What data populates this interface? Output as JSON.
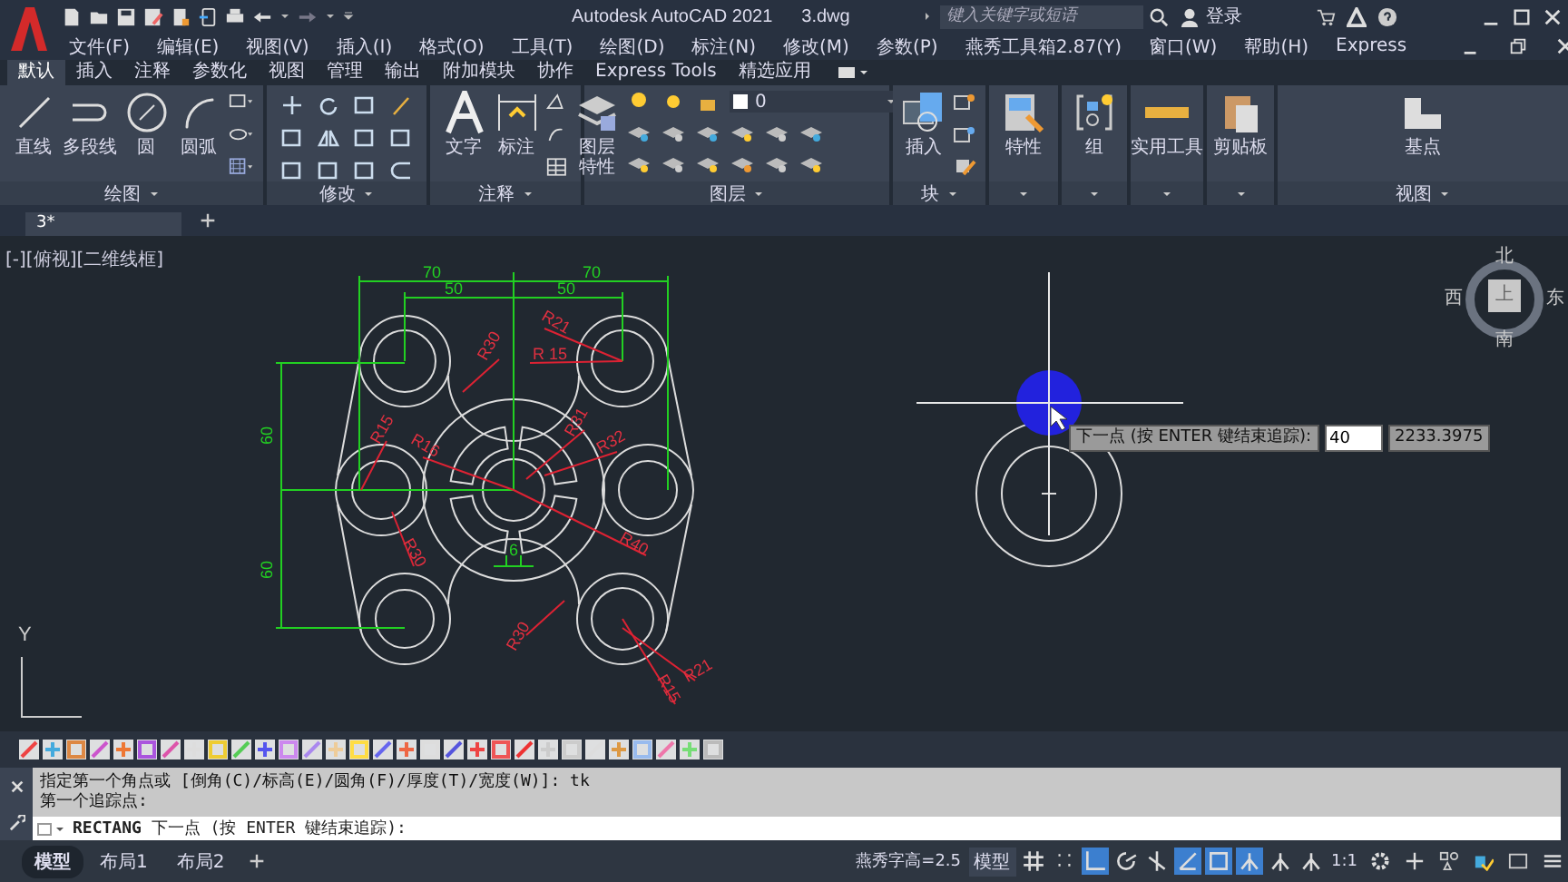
{
  "title_bar": {
    "app_title": "Autodesk AutoCAD 2021",
    "file_name": "3.dwg",
    "search": {
      "placeholder": "键入关键字或短语"
    },
    "sign_in": "登录"
  },
  "menu_bar": [
    "文件(F)",
    "编辑(E)",
    "视图(V)",
    "插入(I)",
    "格式(O)",
    "工具(T)",
    "绘图(D)",
    "标注(N)",
    "修改(M)",
    "参数(P)",
    "燕秀工具箱2.87(Y)",
    "窗口(W)",
    "帮助(H)",
    "Express"
  ],
  "ribbon_tabs": [
    {
      "label": "默认",
      "selected": true
    },
    {
      "label": "插入",
      "selected": false
    },
    {
      "label": "注释",
      "selected": false
    },
    {
      "label": "参数化",
      "selected": false
    },
    {
      "label": "视图",
      "selected": false
    },
    {
      "label": "管理",
      "selected": false
    },
    {
      "label": "输出",
      "selected": false
    },
    {
      "label": "附加模块",
      "selected": false
    },
    {
      "label": "协作",
      "selected": false
    },
    {
      "label": "Express Tools",
      "selected": false
    },
    {
      "label": "精选应用",
      "selected": false
    }
  ],
  "ribbon_panels": [
    {
      "title": "绘图",
      "buttons": [
        "直线",
        "多段线",
        "圆",
        "圆弧"
      ]
    },
    {
      "title": "修改"
    },
    {
      "title": "注释",
      "buttons": [
        "文字",
        "标注"
      ]
    },
    {
      "title": "图层",
      "buttons": [
        "图层特性"
      ],
      "layer": "0"
    },
    {
      "title": "块",
      "buttons": [
        "插入"
      ]
    },
    {
      "buttons": [
        "特性"
      ]
    },
    {
      "buttons": [
        "组"
      ]
    },
    {
      "buttons": [
        "实用工具"
      ]
    },
    {
      "buttons": [
        "剪贴板"
      ]
    },
    {
      "title": "视图",
      "buttons": [
        "基点"
      ]
    }
  ],
  "file_tabs": [
    {
      "label": "3*",
      "selected": true
    }
  ],
  "viewport_label": "[-][俯视][二维线框]",
  "drawing_labels": [
    {
      "text": "70",
      "kind": "dimension"
    },
    {
      "text": "50",
      "kind": "dimension"
    },
    {
      "text": "70",
      "kind": "dimension"
    },
    {
      "text": "50",
      "kind": "dimension"
    },
    {
      "text": "60",
      "kind": "dimension"
    },
    {
      "text": "60",
      "kind": "dimension"
    },
    {
      "text": "6",
      "kind": "dimension"
    },
    {
      "text": "R30",
      "kind": "radius"
    },
    {
      "text": "R21",
      "kind": "radius"
    },
    {
      "text": "R 15",
      "kind": "radius"
    },
    {
      "text": "R15",
      "kind": "radius"
    },
    {
      "text": "R16",
      "kind": "radius"
    },
    {
      "text": "R31",
      "kind": "radius"
    },
    {
      "text": "R32",
      "kind": "radius"
    },
    {
      "text": "R40",
      "kind": "radius"
    },
    {
      "text": "R30",
      "kind": "radius"
    },
    {
      "text": "R30",
      "kind": "radius"
    },
    {
      "text": "R21",
      "kind": "radius"
    },
    {
      "text": "R15",
      "kind": "radius"
    }
  ],
  "tracking_tooltip": {
    "prompt": "下一点 (按 ENTER 键结束追踪):",
    "value": "40",
    "reading": "2233.3975"
  },
  "view_cube": {
    "north": "北",
    "west": "西",
    "face": "上",
    "east": "东",
    "south": "南"
  },
  "ucs_axis": "Y",
  "command_history": [
    "指定第一个角点或 [倒角(C)/标高(E)/圆角(F)/厚度(T)/宽度(W)]: tk",
    "第一个追踪点:"
  ],
  "command_line": "**RECTANG** 下一点 (按 ENTER 键结束追踪):",
  "layout_tabs": [
    {
      "label": "模型",
      "selected": true
    },
    {
      "label": "布局1",
      "selected": false
    },
    {
      "label": "布局2",
      "selected": false
    }
  ],
  "status_bar": {
    "font_height": "燕秀字高=2.5",
    "space": "模型",
    "scale": "1:1",
    "toggles": [
      {
        "on": false
      },
      {
        "on": false
      },
      {
        "on": true
      },
      {
        "on": false
      },
      {
        "on": false
      },
      {
        "on": true
      },
      {
        "on": true
      },
      {
        "on": true
      },
      {
        "on": false
      },
      {
        "on": false
      }
    ]
  }
}
